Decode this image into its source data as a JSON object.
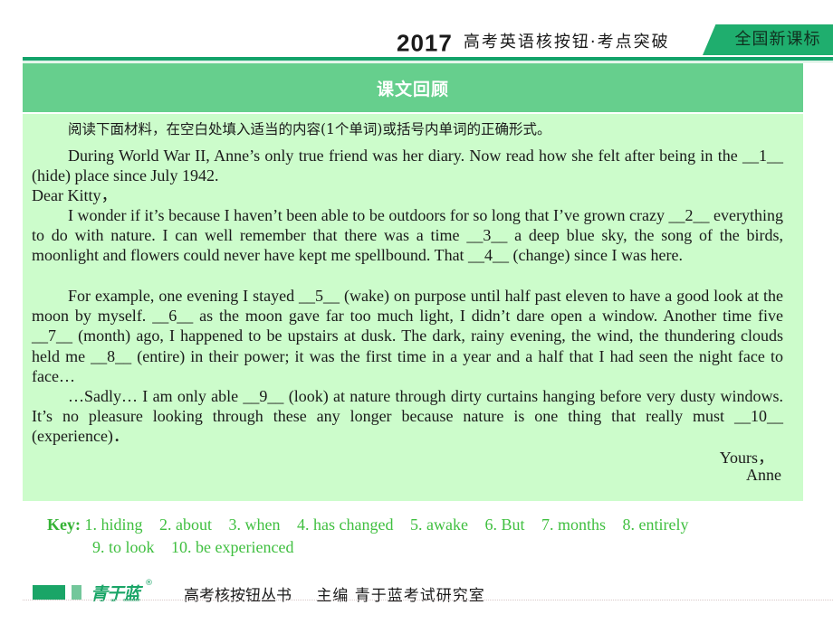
{
  "header": {
    "year": "2017",
    "subtitle": "高考英语核按钮·考点突破",
    "badge": "全国新课标"
  },
  "section": {
    "title": "课文回顾"
  },
  "passage": {
    "instruction": "阅读下面材料，在空白处填入适当的内容(1个单词)或括号内单词的正确形式。",
    "intro": "During World War II, Anne’s only true friend was her diary. Now read how she felt after being in the __1__ (hide) place since July 1942.",
    "salutation": "Dear Kitty，",
    "paragraph1": "I wonder if it’s because I haven’t been able to be outdoors for so long that I’ve grown crazy __2__ everything to do with nature. I can well remember that there was a time __3__ a deep blue sky, the song of the birds, moonlight and flowers could never have kept me spellbound. That  __4__ (change) since I was here.",
    "paragraph2": "For example, one evening I stayed __5__ (wake) on purpose until half past eleven to have a good look at the moon by myself. __6__ as the moon gave far too much light, I didn’t dare open a window. Another  time five __7__ (month) ago, I happened to be upstairs at dusk. The dark, rainy evening, the wind, the thundering clouds held me __8__ (entire) in their power; it was the first time in a year and a half that I had seen the night face to face…",
    "paragraph3": "…Sadly… I am only able __9__ (look) at nature through dirty curtains hanging before very dusty windows. It’s no pleasure looking through these any longer because nature is one thing that really must __10__  (experience)．",
    "closing": "Yours，",
    "signature": "Anne"
  },
  "key": {
    "label": "Key:",
    "answers": [
      "1. hiding",
      "2. about",
      "3. when",
      "4. has changed",
      "5. awake",
      "6. But",
      "7. months",
      "8. entirely",
      "9. to look",
      "10. be experienced"
    ]
  },
  "footer": {
    "logo": "青于蓝",
    "registered": "®",
    "series": "高考核按钮丛书",
    "editor": "主编 青于蓝考试研究室"
  },
  "colors": {
    "accent_dark": "#12a36a",
    "section_bar": "#66cf8d",
    "content_bg": "#ccfccb",
    "key_text": "#3fbf3f"
  }
}
